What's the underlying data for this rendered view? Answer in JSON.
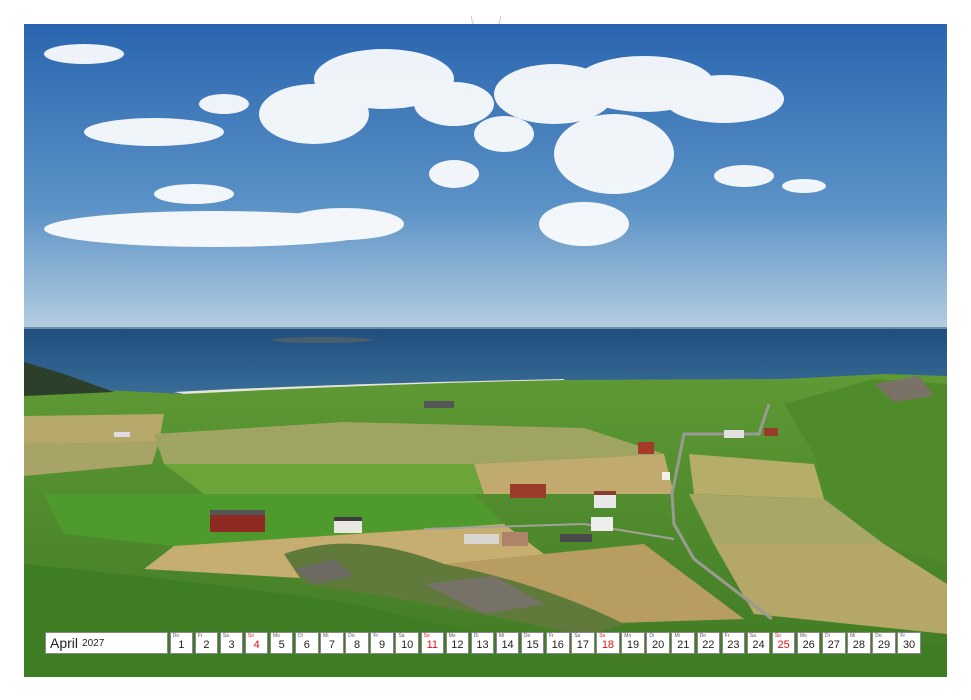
{
  "calendar": {
    "month": "April",
    "year": "2027",
    "days": [
      {
        "num": "1",
        "dow": "Do",
        "sunday": false
      },
      {
        "num": "2",
        "dow": "Fr",
        "sunday": false
      },
      {
        "num": "3",
        "dow": "Sa",
        "sunday": false
      },
      {
        "num": "4",
        "dow": "So",
        "sunday": true
      },
      {
        "num": "5",
        "dow": "Mo",
        "sunday": false
      },
      {
        "num": "6",
        "dow": "Di",
        "sunday": false
      },
      {
        "num": "7",
        "dow": "Mi",
        "sunday": false
      },
      {
        "num": "8",
        "dow": "Do",
        "sunday": false
      },
      {
        "num": "9",
        "dow": "Fr",
        "sunday": false
      },
      {
        "num": "10",
        "dow": "Sa",
        "sunday": false
      },
      {
        "num": "11",
        "dow": "So",
        "sunday": true
      },
      {
        "num": "12",
        "dow": "Mo",
        "sunday": false
      },
      {
        "num": "13",
        "dow": "Di",
        "sunday": false
      },
      {
        "num": "14",
        "dow": "Mi",
        "sunday": false
      },
      {
        "num": "15",
        "dow": "Do",
        "sunday": false
      },
      {
        "num": "16",
        "dow": "Fr",
        "sunday": false
      },
      {
        "num": "17",
        "dow": "Sa",
        "sunday": false
      },
      {
        "num": "18",
        "dow": "So",
        "sunday": true
      },
      {
        "num": "19",
        "dow": "Mo",
        "sunday": false
      },
      {
        "num": "20",
        "dow": "Di",
        "sunday": false
      },
      {
        "num": "21",
        "dow": "Mi",
        "sunday": false
      },
      {
        "num": "22",
        "dow": "Do",
        "sunday": false
      },
      {
        "num": "23",
        "dow": "Fr",
        "sunday": false
      },
      {
        "num": "24",
        "dow": "Sa",
        "sunday": false
      },
      {
        "num": "25",
        "dow": "So",
        "sunday": true
      },
      {
        "num": "26",
        "dow": "Mo",
        "sunday": false
      },
      {
        "num": "27",
        "dow": "Di",
        "sunday": false
      },
      {
        "num": "28",
        "dow": "Mi",
        "sunday": false
      },
      {
        "num": "29",
        "dow": "Do",
        "sunday": false
      },
      {
        "num": "30",
        "dow": "Fr",
        "sunday": false
      }
    ]
  },
  "colors": {
    "sunday": "#dd1111",
    "sky_top": "#2f6fb8",
    "sky_bottom": "#a9c7de",
    "sea": "#27527f",
    "meadow": "#4e8a2a"
  }
}
